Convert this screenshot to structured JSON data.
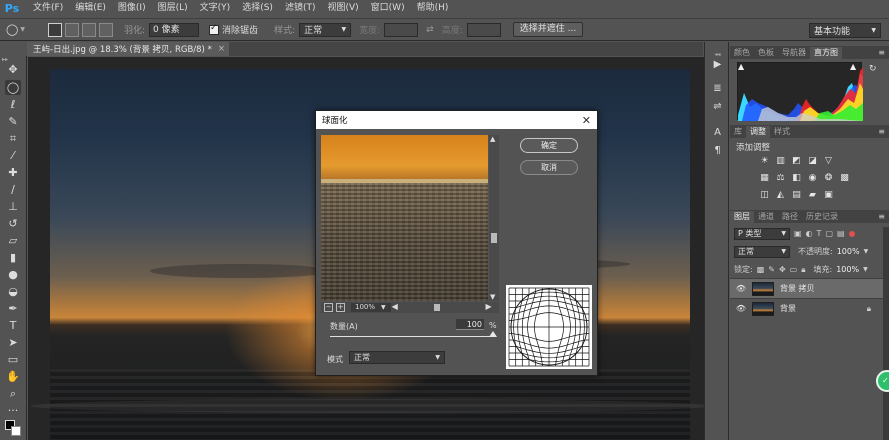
{
  "app": {
    "logo": "Ps"
  },
  "menu": [
    "文件(F)",
    "编辑(E)",
    "图像(I)",
    "图层(L)",
    "文字(Y)",
    "选择(S)",
    "滤镜(T)",
    "视图(V)",
    "窗口(W)",
    "帮助(H)"
  ],
  "options": {
    "feather_label": "羽化:",
    "feather_value": "0 像素",
    "antialias_label": "消除锯齿",
    "style_label": "样式:",
    "style_value": "正常",
    "width_label": "宽度:",
    "height_label": "高度:",
    "select_mask_button": "选择并遮住 ...",
    "workspace": "基本功能"
  },
  "document": {
    "tab_title": "王屿-日出.jpg @ 18.3% (背景 拷贝, RGB/8) *",
    "close": "×"
  },
  "panels": {
    "top_tabs": [
      "颜色",
      "色板",
      "导航器",
      "直方图"
    ],
    "top_active": 3,
    "mid_tabs": [
      "库",
      "调整",
      "样式"
    ],
    "mid_active": 1,
    "adjust_title": "添加调整",
    "layer_tabs": [
      "图层",
      "通道",
      "路径",
      "历史记录"
    ],
    "layer_active": 0,
    "filter_kind": "P 类型",
    "blend_mode": "正常",
    "opacity_label": "不透明度:",
    "opacity_value": "100%",
    "lock_label": "锁定:",
    "fill_label": "填充:",
    "fill_value": "100%",
    "layers": [
      {
        "name": "背景 拷贝",
        "selected": true,
        "locked": false
      },
      {
        "name": "背景",
        "selected": false,
        "locked": true
      }
    ]
  },
  "dialog": {
    "title": "球面化",
    "close": "✕",
    "ok": "确定",
    "cancel": "取消",
    "zoom": "100%",
    "amount_label": "数量(A)",
    "amount_value": "100",
    "amount_unit": "%",
    "amount_fraction": 1.0,
    "mode_label": "模式",
    "mode_value": "正常"
  }
}
